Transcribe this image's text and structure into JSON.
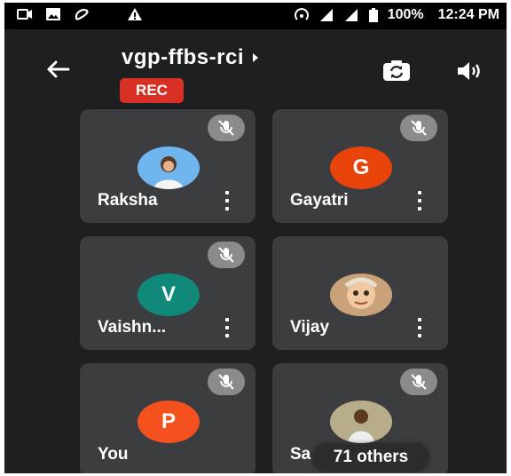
{
  "status_bar": {
    "battery": "100%",
    "time": "12:24 PM",
    "icons": [
      "video-recording-icon",
      "image-icon",
      "airtel-icon",
      "warning-icon",
      "hotspot-icon",
      "signal-icon",
      "signal-icon",
      "battery-icon"
    ]
  },
  "meeting": {
    "code": "vgp-ffbs-rci",
    "rec_label": "REC",
    "others_label": "71 others"
  },
  "participants": [
    {
      "name": "Raksha",
      "avatar_type": "photo",
      "initial": "",
      "color": "#5ba5e6",
      "muted": true
    },
    {
      "name": "Gayatri",
      "avatar_type": "initial",
      "initial": "G",
      "color": "#e8430a",
      "muted": true
    },
    {
      "name": "Vaishn...",
      "avatar_type": "initial",
      "initial": "V",
      "color": "#11897a",
      "muted": true
    },
    {
      "name": "Vijay",
      "avatar_type": "photo",
      "initial": "",
      "color": "#d9a06a",
      "muted": false
    },
    {
      "name": "You",
      "avatar_type": "initial",
      "initial": "P",
      "color": "#f4511e",
      "muted": true
    },
    {
      "name": "Sa",
      "avatar_type": "photo",
      "initial": "",
      "color": "#8a7a5a",
      "muted": true
    }
  ],
  "colors": {
    "background": "#1e1f21",
    "tile": "#3c3d40",
    "rec": "#d93025"
  }
}
